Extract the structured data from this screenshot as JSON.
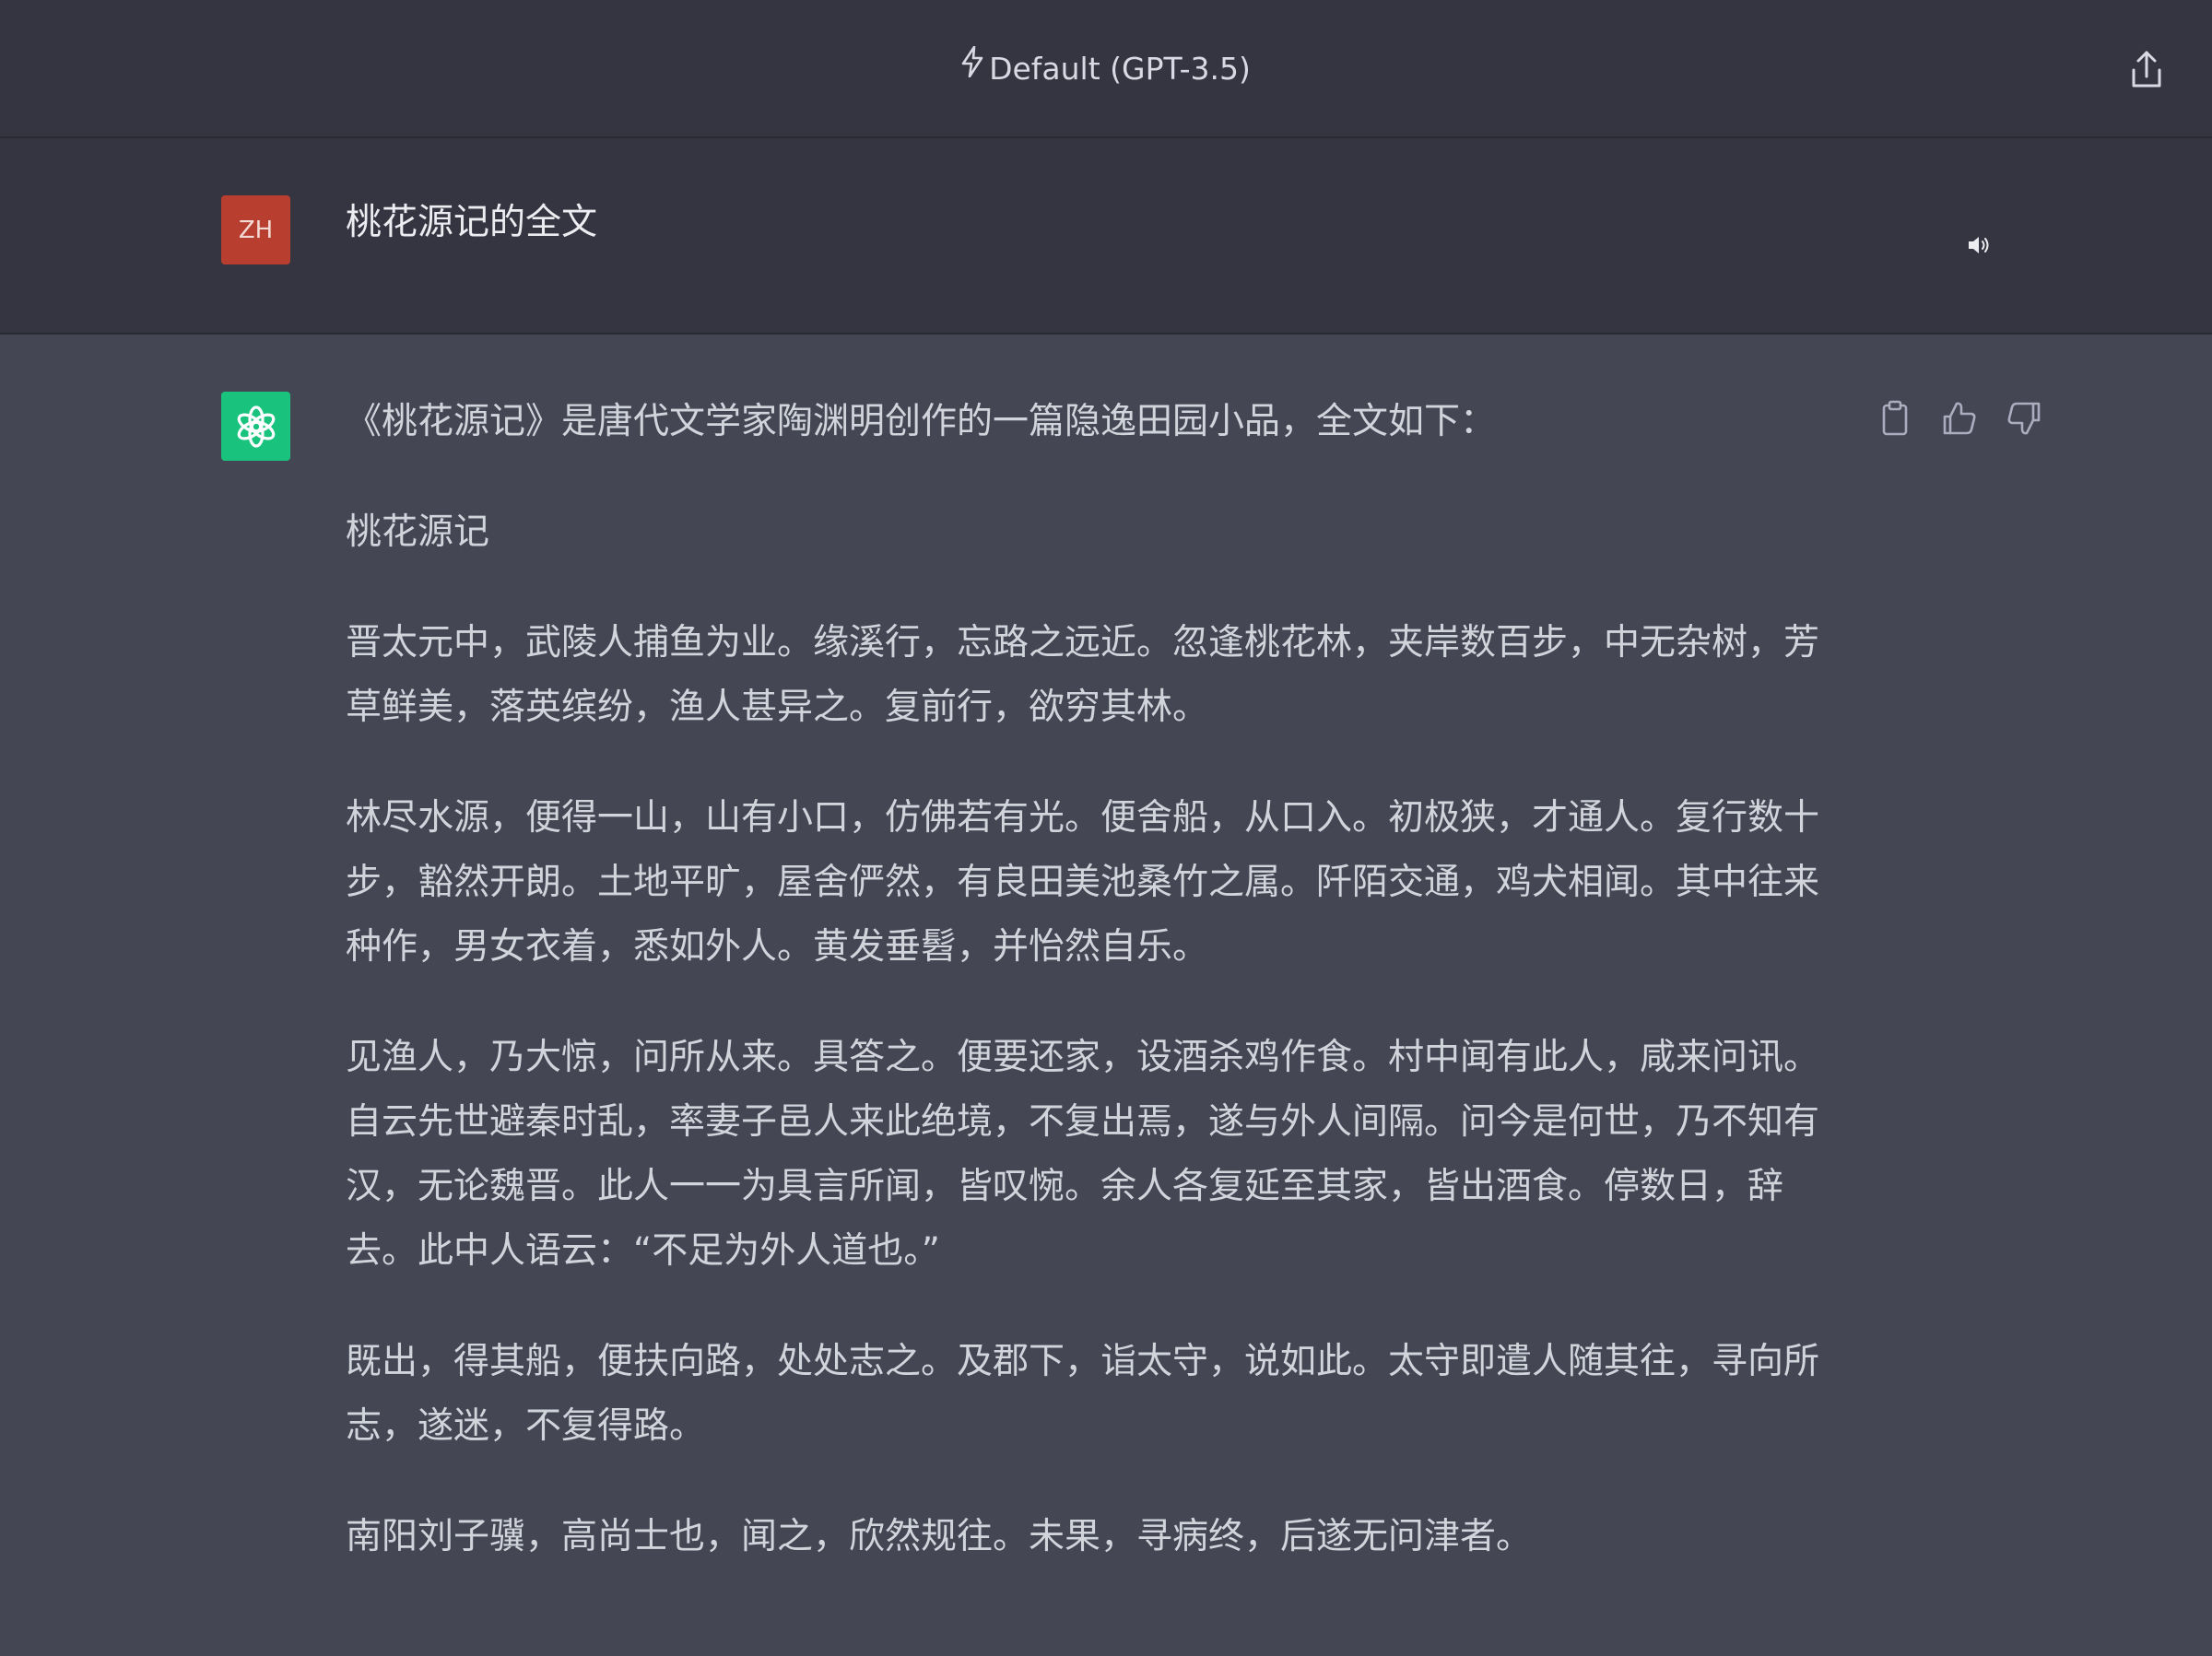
{
  "header": {
    "model_label": "Default (GPT-3.5)",
    "icons": [
      "lightning-icon",
      "share-icon"
    ]
  },
  "user_message": {
    "avatar_initials": "ZH",
    "avatar_color": "#b83f30",
    "text": "桃花源记的全文"
  },
  "assistant_message": {
    "avatar_color": "#19c37d",
    "paragraphs": [
      "《桃花源记》是唐代文学家陶渊明创作的一篇隐逸田园小品，全文如下：",
      "桃花源记",
      "晋太元中，武陵人捕鱼为业。缘溪行，忘路之远近。忽逢桃花林，夹岸数百步，中无杂树，芳草鲜美，落英缤纷，渔人甚异之。复前行，欲穷其林。",
      "林尽水源，便得一山，山有小口，仿佛若有光。便舍船，从口入。初极狭，才通人。复行数十步，豁然开朗。土地平旷，屋舍俨然，有良田美池桑竹之属。阡陌交通，鸡犬相闻。其中往来种作，男女衣着，悉如外人。黄发垂髫，并怡然自乐。",
      "见渔人，乃大惊，问所从来。具答之。便要还家，设酒杀鸡作食。村中闻有此人，咸来问讯。自云先世避秦时乱，率妻子邑人来此绝境，不复出焉，遂与外人间隔。问今是何世，乃不知有汉，无论魏晋。此人一一为具言所闻，皆叹惋。余人各复延至其家，皆出酒食。停数日，辞去。此中人语云：“不足为外人道也。”",
      "既出，得其船，便扶向路，处处志之。及郡下，诣太守，说如此。太守即遣人随其往，寻向所志，遂迷，不复得路。",
      "南阳刘子骥，高尚士也，闻之，欣然规往。未果，寻病终，后遂无问津者。"
    ]
  },
  "colors": {
    "background_main": "#444654",
    "background_header": "#343541"
  }
}
